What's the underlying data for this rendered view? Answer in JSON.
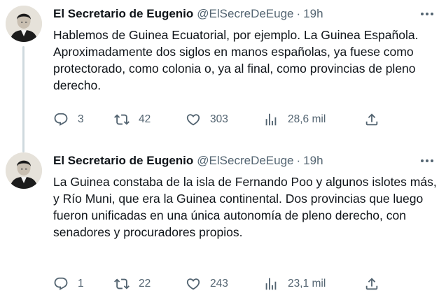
{
  "tweets": [
    {
      "author_name": "El Secretario de Eugenio",
      "handle": "@ElSecreDeEuge",
      "separator": "·",
      "time": "19h",
      "text": "Hablemos de Guinea Ecuatorial, por ejemplo. La Guinea Española. Aproximadamente dos siglos en manos españolas, ya fuese como protectorado, como colonia o, ya al final, como provincias de pleno derecho.",
      "replies": "3",
      "retweets": "42",
      "likes": "303",
      "views": "28,6 mil"
    },
    {
      "author_name": "El Secretario de Eugenio",
      "handle": "@ElSecreDeEuge",
      "separator": "·",
      "time": "19h",
      "text": "La Guinea constaba de la isla de Fernando Poo y algunos islotes más, y Río Muni, que era la Guinea continental. Dos provincias que luego fueron unificadas en una única autonomía de pleno derecho, con senadores y procuradores propios.",
      "replies": "1",
      "retweets": "22",
      "likes": "243",
      "views": "23,1 mil"
    }
  ],
  "icons": {
    "reply": "reply-icon",
    "retweet": "retweet-icon",
    "like": "heart-icon",
    "views": "views-icon",
    "share": "share-icon",
    "more": "more-icon"
  },
  "colors": {
    "text": "#0f1419",
    "secondary": "#536471",
    "thread_line": "#cfd9de"
  }
}
